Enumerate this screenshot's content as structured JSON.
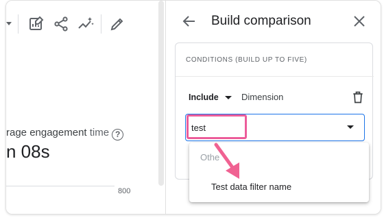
{
  "toolbar": {
    "icons": [
      "dropdown-caret",
      "edit-report-icon",
      "share-icon",
      "insights-icon",
      "pencil-icon"
    ]
  },
  "report": {
    "metric_label_main": "rage engagement ",
    "metric_label_light": "time",
    "help_glyph": "?",
    "metric_value": "n 08s",
    "axis_value": "800"
  },
  "panel": {
    "title": "Build comparison",
    "back_icon": "arrow-back-icon",
    "close_icon": "close-icon",
    "conditions_title": "CONDITIONS (BUILD UP TO FIVE)",
    "include_label": "Include",
    "dimension_label": "Dimension",
    "search": {
      "value": "test"
    },
    "dropdown": {
      "group_label": "Othe",
      "item_label": "Test data filter name"
    }
  },
  "colors": {
    "accent": "#1a73e8",
    "highlight": "#ec5c9a",
    "arrow": "#f06292"
  }
}
